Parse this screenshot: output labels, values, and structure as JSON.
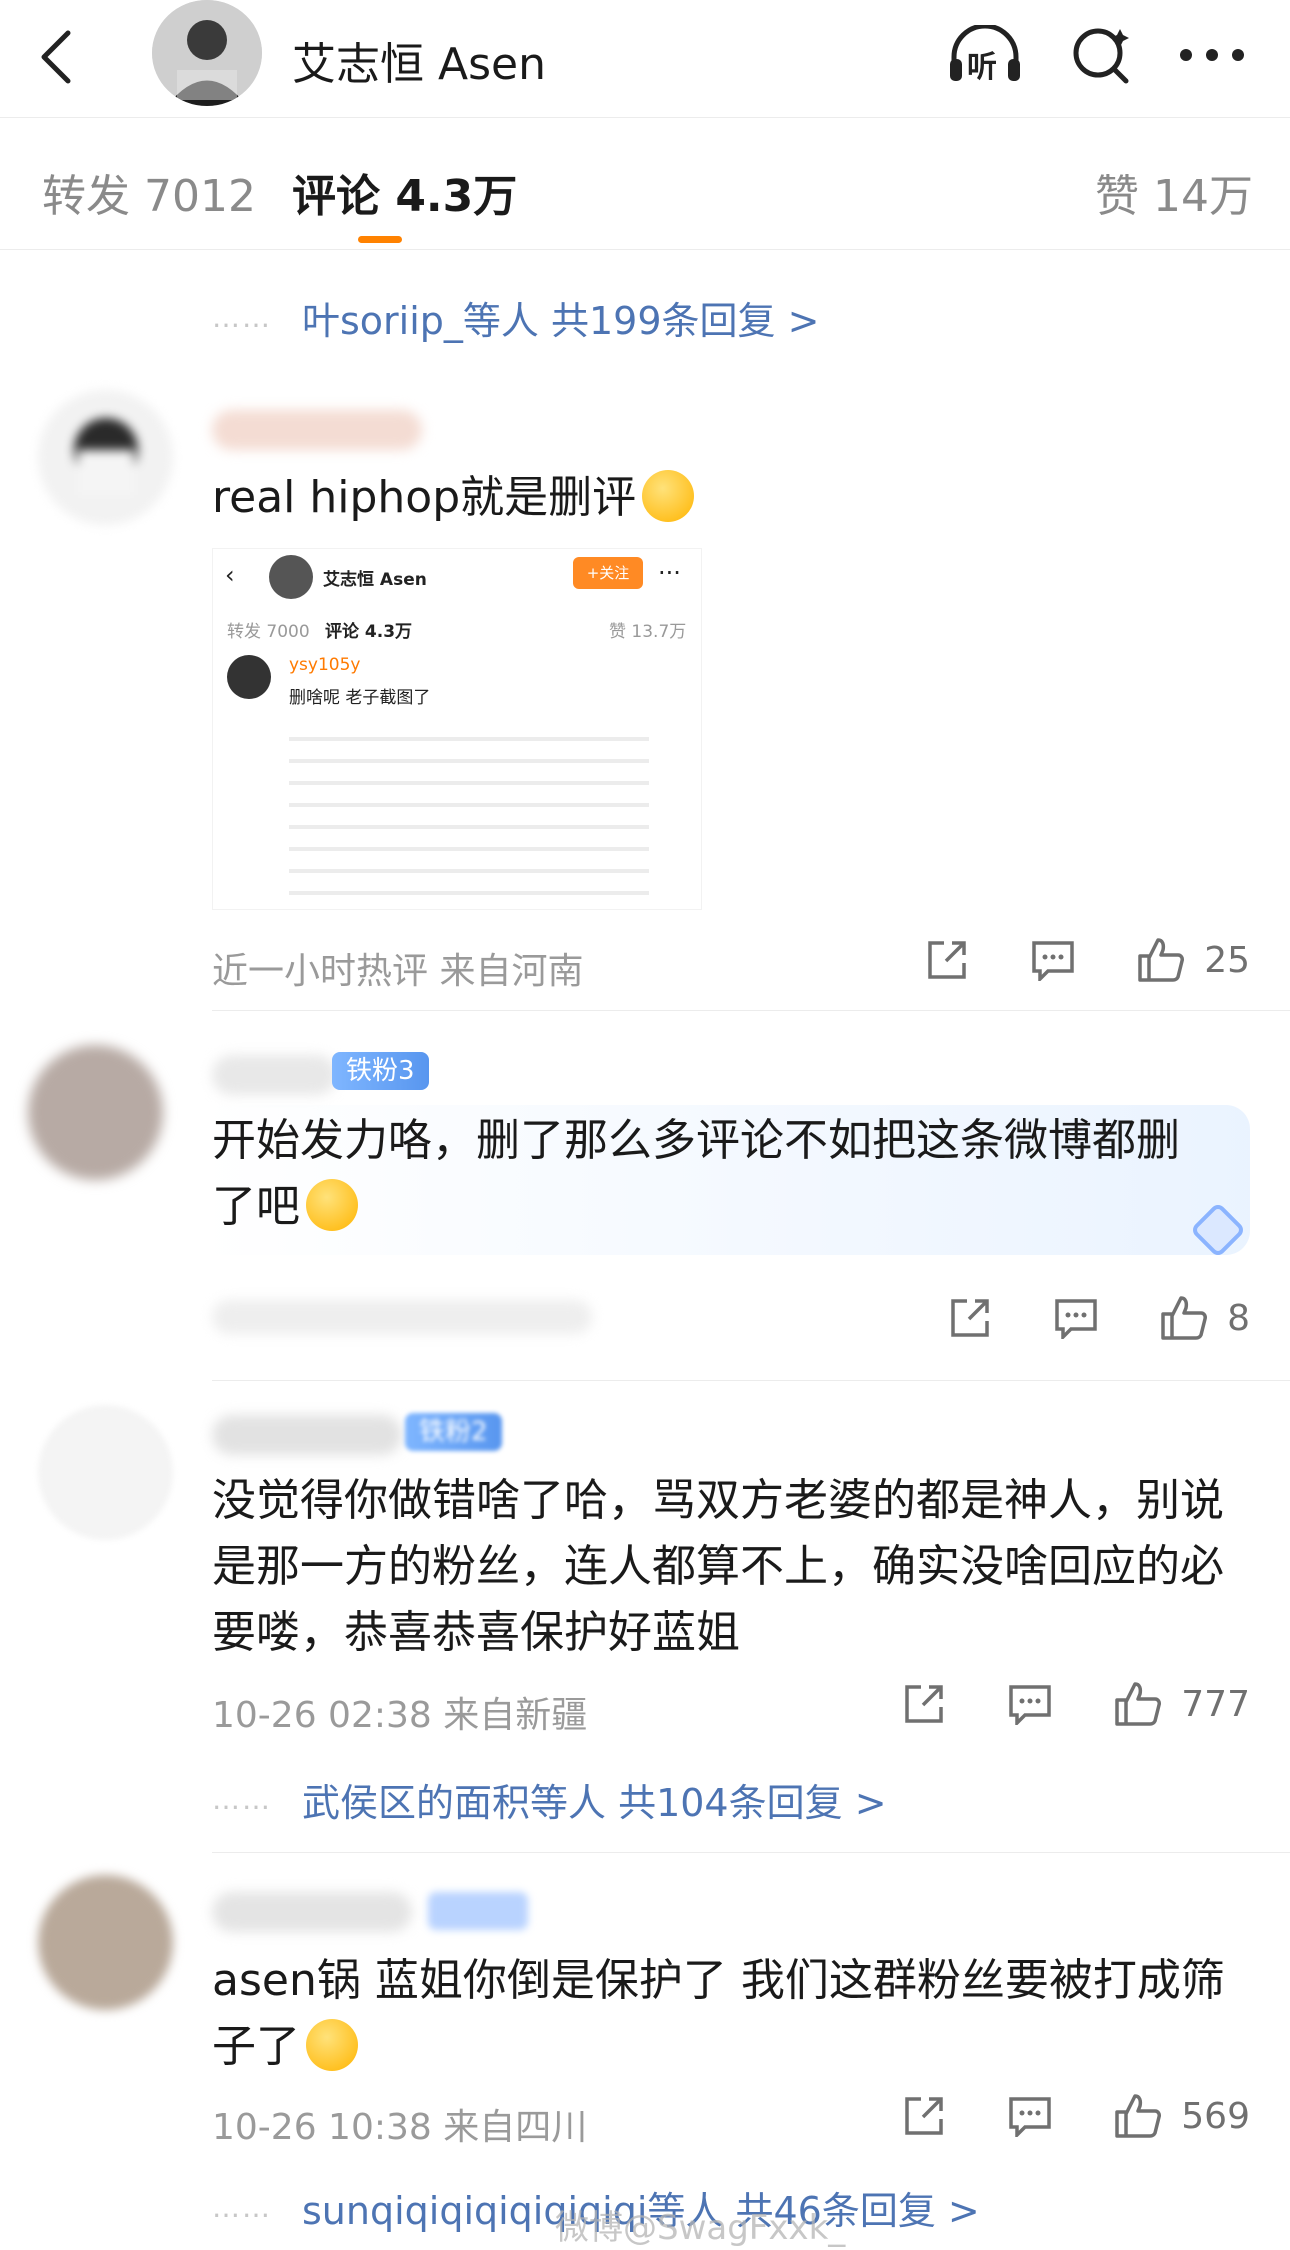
{
  "header": {
    "title": "艾志恒 Asen",
    "icons": [
      "back-icon",
      "listen-icon",
      "search-icon",
      "more-icon"
    ],
    "listen_label": "听"
  },
  "tabs": {
    "repost": "转发 7012",
    "comments": "评论 4.3万",
    "likes": "赞 14万",
    "accent": "#ff8200"
  },
  "top_reply_summary": {
    "dots": "……",
    "text": "叶soriip_等人  共199条回复 >"
  },
  "comments": [
    {
      "text": "real hiphop就是删评",
      "emoji": "crying-face-emoji",
      "meta": "近一小时热评  来自河南",
      "likes": "25",
      "screenshot": {
        "title": "艾志恒 Asen",
        "follow": "+关注",
        "repost": "转发 7000",
        "comments": "评论 4.3万",
        "likes": "赞 13.7万",
        "user": "ysy105y",
        "line": "删啥呢 老子截图了"
      }
    },
    {
      "badge": "铁粉3",
      "text": "开始发力咯，删了那么多评论不如把这条微博都删了吧",
      "emoji": "sweat-face-emoji",
      "likes": "8"
    },
    {
      "badge": "铁粉2",
      "text": "没觉得你做错啥了哈，骂双方老婆的都是神人，别说是那一方的粉丝，连人都算不上，确实没啥回应的必要喽，恭喜恭喜保护好蓝姐",
      "meta": "10-26 02:38  来自新疆",
      "likes": "777",
      "reply_summary": "武侯区的面积等人  共104条回复 >"
    },
    {
      "text": "asen锅 蓝姐你倒是保护了 我们这群粉丝要被打成筛子了",
      "emoji": "crying-face-emoji",
      "meta": "10-26 10:38  来自四川",
      "likes": "569",
      "reply_summary": "sunqiqiqiqiqiqiqiqi等人  共46条回复 >"
    }
  ],
  "watermark": "微博@SwagFxxk_",
  "colors": {
    "link": "#4d74b3",
    "meta": "#9a9a9a",
    "badge": "#5896ef"
  }
}
